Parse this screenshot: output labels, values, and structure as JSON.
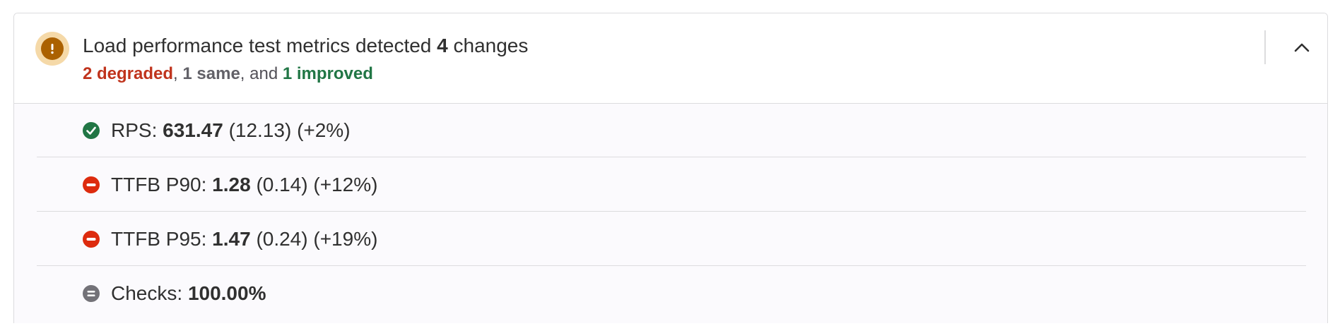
{
  "header": {
    "title_prefix": "Load performance test metrics detected",
    "change_count": "4",
    "title_suffix": "changes",
    "summary": {
      "degraded": "2 degraded",
      "sep1": ", ",
      "same": "1 same",
      "sep2": ", and ",
      "improved": "1 improved"
    },
    "status_icon": "warning-icon",
    "collapse_icon": "chevron-up-icon"
  },
  "metrics": [
    {
      "icon": "check-circle-icon",
      "status": "improved",
      "label": "RPS:",
      "value": "631.47",
      "delta": "(12.13)",
      "percent": "(+2%)"
    },
    {
      "icon": "minus-circle-icon",
      "status": "degraded",
      "label": "TTFB P90:",
      "value": "1.28",
      "delta": "(0.14)",
      "percent": "(+12%)"
    },
    {
      "icon": "minus-circle-icon",
      "status": "degraded",
      "label": "TTFB P95:",
      "value": "1.47",
      "delta": "(0.24)",
      "percent": "(+19%)"
    },
    {
      "icon": "equal-circle-icon",
      "status": "same",
      "label": "Checks:",
      "value": "100.00%",
      "delta": "",
      "percent": ""
    }
  ],
  "colors": {
    "degraded": "#c0341d",
    "same": "#626168",
    "improved": "#217645",
    "warning": "#ab6100",
    "warning_bg": "#f5d9a8"
  }
}
